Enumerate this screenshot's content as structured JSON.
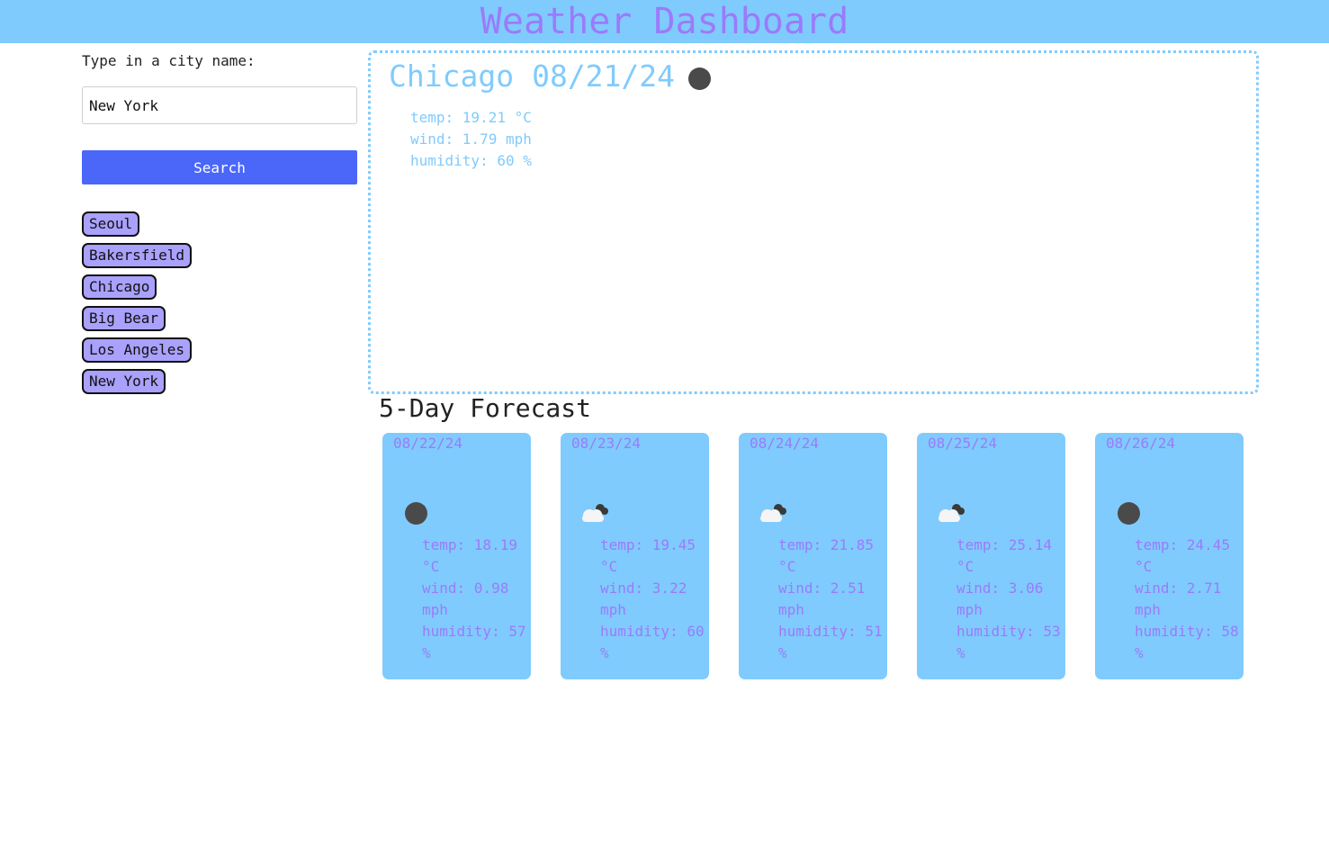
{
  "header": {
    "title": "Weather Dashboard"
  },
  "sidebar": {
    "input_label": "Type in a city name:",
    "input_value": "New York",
    "search_label": "Search",
    "history": [
      "Seoul",
      "Bakersfield",
      "Chicago",
      "Big Bear",
      "Los Angeles",
      "New York"
    ]
  },
  "current": {
    "city": "Chicago",
    "date": "08/21/24",
    "icon": "moon-icon",
    "temp": "temp: 19.21 °C",
    "wind": "wind: 1.79 mph",
    "humidity": "humidity: 60 %"
  },
  "forecast": {
    "title": "5-Day Forecast",
    "days": [
      {
        "date": "08/22/24",
        "icon": "moon-icon",
        "temp": "temp: 18.19 °C",
        "wind": "wind: 0.98 mph",
        "humidity": "humidity: 57 %"
      },
      {
        "date": "08/23/24",
        "icon": "cloud-icon",
        "temp": "temp: 19.45 °C",
        "wind": "wind: 3.22 mph",
        "humidity": "humidity: 60 %"
      },
      {
        "date": "08/24/24",
        "icon": "cloud-icon",
        "temp": "temp: 21.85 °C",
        "wind": "wind: 2.51 mph",
        "humidity": "humidity: 51 %"
      },
      {
        "date": "08/25/24",
        "icon": "cloud-icon",
        "temp": "temp: 25.14 °C",
        "wind": "wind: 3.06 mph",
        "humidity": "humidity: 53 %"
      },
      {
        "date": "08/26/24",
        "icon": "moon-icon",
        "temp": "temp: 24.45 °C",
        "wind": "wind: 2.71 mph",
        "humidity": "humidity: 58 %"
      }
    ]
  },
  "colors": {
    "header_bg": "#80cbfd",
    "title": "#9a7bfb",
    "search_button": "#4a67fa",
    "history_button": "#a9a1fb",
    "card_bg": "#80cbfd"
  }
}
